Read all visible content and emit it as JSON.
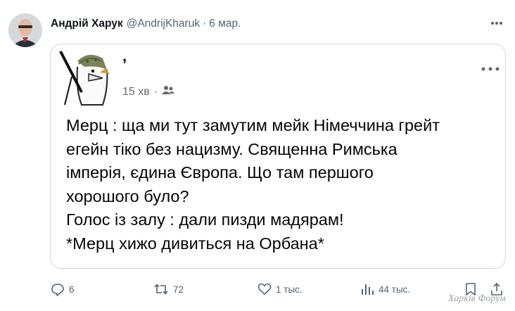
{
  "tweet": {
    "author_name": "Андрій Харук",
    "handle": "@AndrijKharuk",
    "separator": "·",
    "time": "6 мар.",
    "more_icon": "more-horizontal-icon"
  },
  "embedded_post": {
    "author": "ʼ",
    "time": "15 хв",
    "separator": "·",
    "audience_icon": "friends-icon",
    "lines": [
      "Мерц : ща ми тут замутим мейк Німеччина грейт",
      "егейн тіко без нацизму. Священна Римська",
      "імперія, єдина Європа. Що там першого",
      "хорошого було?",
      "Голос із залу : дали пизди мадярам!",
      "*Мерц хижо дивиться на Орбана*"
    ]
  },
  "actions": {
    "replies": "6",
    "reposts": "72",
    "likes": "1 тыс.",
    "views": "44 тыс."
  },
  "watermark": "Харків Форум"
}
